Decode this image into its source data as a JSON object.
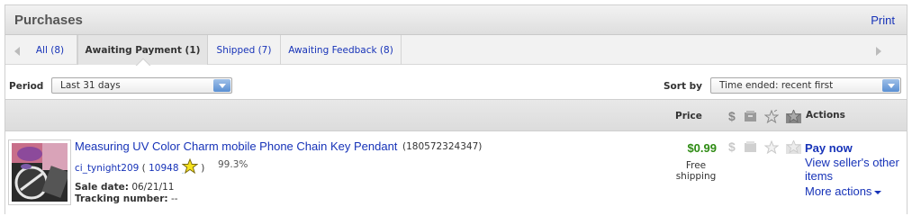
{
  "header": {
    "title": "Purchases",
    "print_label": "Print"
  },
  "tabs": [
    {
      "label": "All (8)"
    },
    {
      "label": "Awaiting Payment (1)"
    },
    {
      "label": "Shipped (7)"
    },
    {
      "label": "Awaiting Feedback (8)"
    }
  ],
  "filters": {
    "period_label": "Period",
    "period_value": "Last 31 days",
    "sort_label": "Sort by",
    "sort_value": "Time ended: recent first"
  },
  "columns": {
    "price": "Price",
    "actions": "Actions",
    "icons": [
      "dollar-icon",
      "box-icon",
      "star-icon",
      "feedback-star-icon"
    ]
  },
  "item": {
    "title": "Measuring UV Color Charm mobile Phone Chain Key Pendant",
    "item_number": "(180572324347)",
    "seller": "ci_tynight209",
    "feedback_score": "10948",
    "paren_open": "(",
    "paren_close": ")",
    "positive_pct": "99.3%",
    "sale_date_label": "Sale date:",
    "sale_date": "06/21/11",
    "tracking_label": "Tracking number:",
    "tracking_value": "--",
    "price": "$0.99",
    "shipping": "Free shipping",
    "actions": {
      "pay_now": "Pay now",
      "view_other": "View seller's other items",
      "more_actions": "More actions"
    }
  },
  "colors": {
    "link": "#1733b8",
    "price": "#2e8b13",
    "star": "#f5e21b"
  }
}
